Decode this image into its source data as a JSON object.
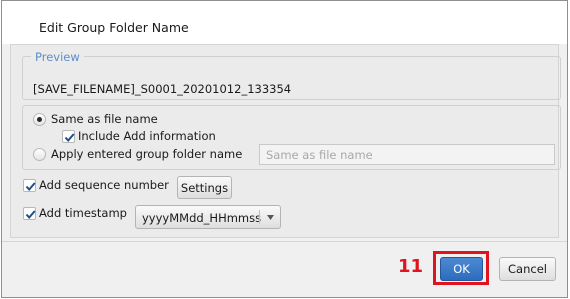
{
  "dialog": {
    "title": "Edit Group Folder Name"
  },
  "preview": {
    "legend": "Preview",
    "value": "[SAVE_FILENAME]_S0001_20201012_133354"
  },
  "naming": {
    "same_as_file_name": {
      "label": "Same as file name",
      "checked": true
    },
    "include_add_information": {
      "label": "Include Add information",
      "checked": true
    },
    "apply_entered": {
      "label": "Apply entered group folder name",
      "checked": false
    },
    "folder_name_input": {
      "value": "",
      "placeholder": "Same as file name"
    }
  },
  "sequence": {
    "label": "Add sequence number",
    "checked": true,
    "settings_label": "Settings"
  },
  "timestamp": {
    "label": "Add timestamp",
    "checked": true,
    "format_value": "yyyyMMdd_HHmmss"
  },
  "footer": {
    "step_number": "11",
    "ok_label": "OK",
    "cancel_label": "Cancel"
  },
  "colors": {
    "annotation_red": "#e0141e",
    "primary_button": "#3a7bc8",
    "legend_blue": "#5b8fc9"
  }
}
